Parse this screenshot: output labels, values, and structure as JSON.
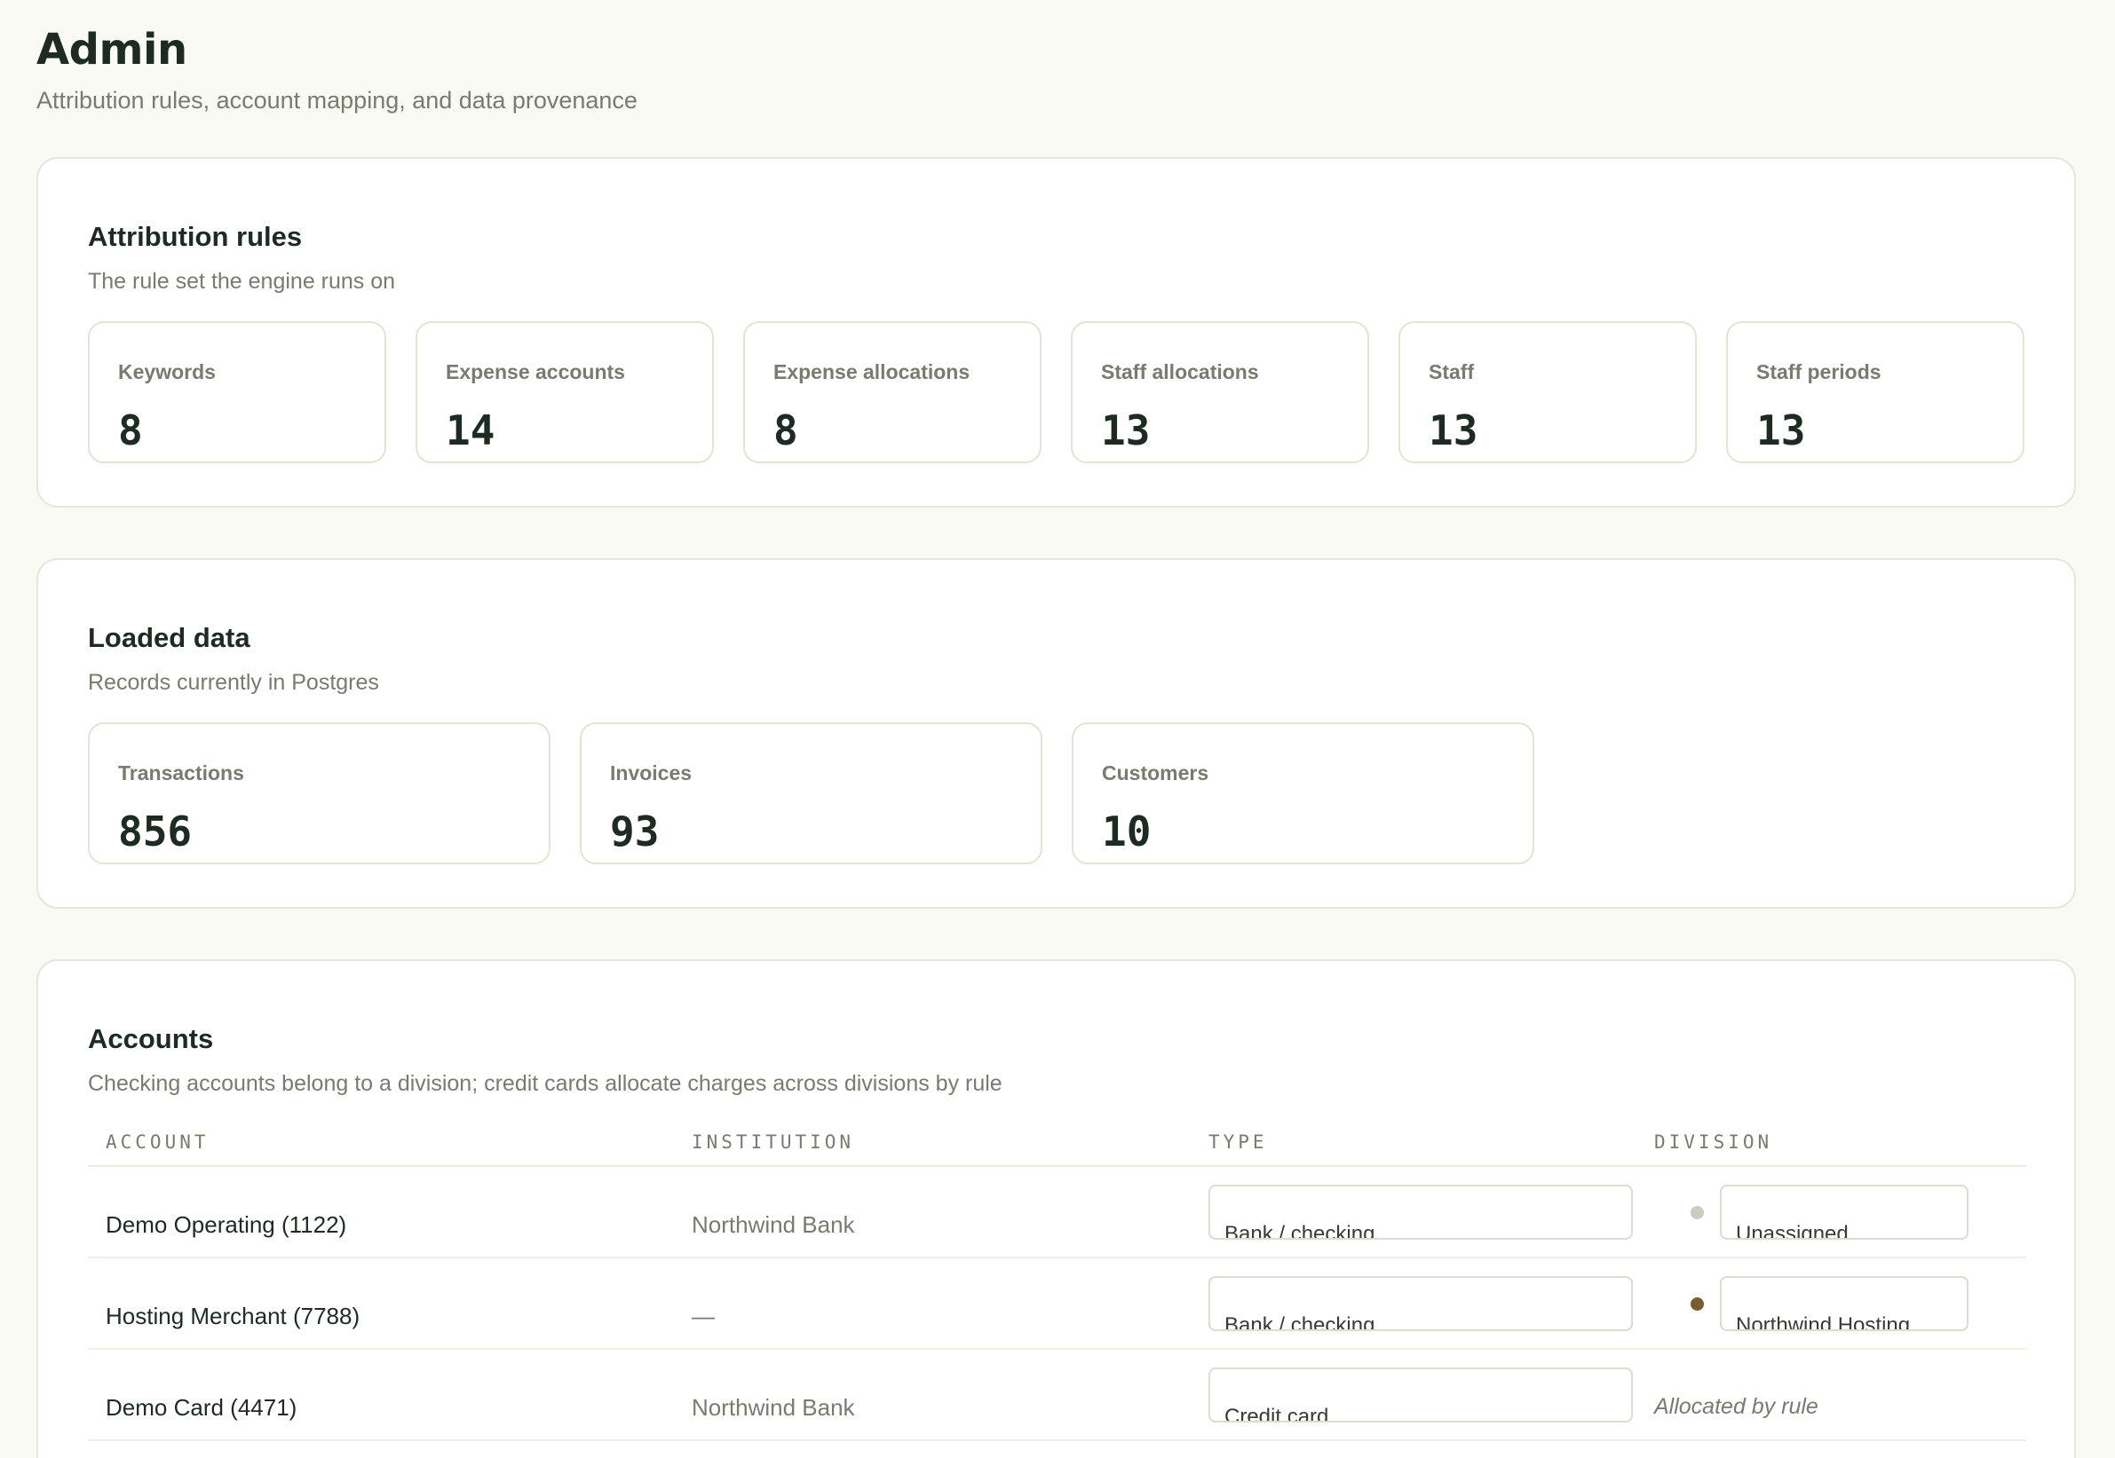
{
  "header": {
    "title": "Admin",
    "subtitle": "Attribution rules, account mapping, and data provenance"
  },
  "attribution_rules": {
    "title": "Attribution rules",
    "subtitle": "The rule set the engine runs on",
    "stats": [
      {
        "label": "Keywords",
        "value": "8"
      },
      {
        "label": "Expense accounts",
        "value": "14"
      },
      {
        "label": "Expense allocations",
        "value": "8"
      },
      {
        "label": "Staff allocations",
        "value": "13"
      },
      {
        "label": "Staff",
        "value": "13"
      },
      {
        "label": "Staff periods",
        "value": "13"
      }
    ]
  },
  "loaded_data": {
    "title": "Loaded data",
    "subtitle": "Records currently in Postgres",
    "stats": [
      {
        "label": "Transactions",
        "value": "856"
      },
      {
        "label": "Invoices",
        "value": "93"
      },
      {
        "label": "Customers",
        "value": "10"
      }
    ]
  },
  "accounts": {
    "title": "Accounts",
    "subtitle": "Checking accounts belong to a division; credit cards allocate charges across divisions by rule",
    "columns": [
      "ACCOUNT",
      "INSTITUTION",
      "TYPE",
      "DIVISION"
    ],
    "rows": [
      {
        "account": "Demo Operating (1122)",
        "institution": "Northwind Bank",
        "type": "Bank / checking",
        "division": "Unassigned",
        "dot_color": "#c9cdbf"
      },
      {
        "account": "Hosting Merchant (7788)",
        "institution": "—",
        "type": "Bank / checking",
        "division": "Northwind Hosting",
        "dot_color": "#7a5c2e"
      },
      {
        "account": "Demo Card (4471)",
        "institution": "Northwind Bank",
        "type": "Credit card",
        "division_note": "Allocated by rule"
      }
    ]
  }
}
